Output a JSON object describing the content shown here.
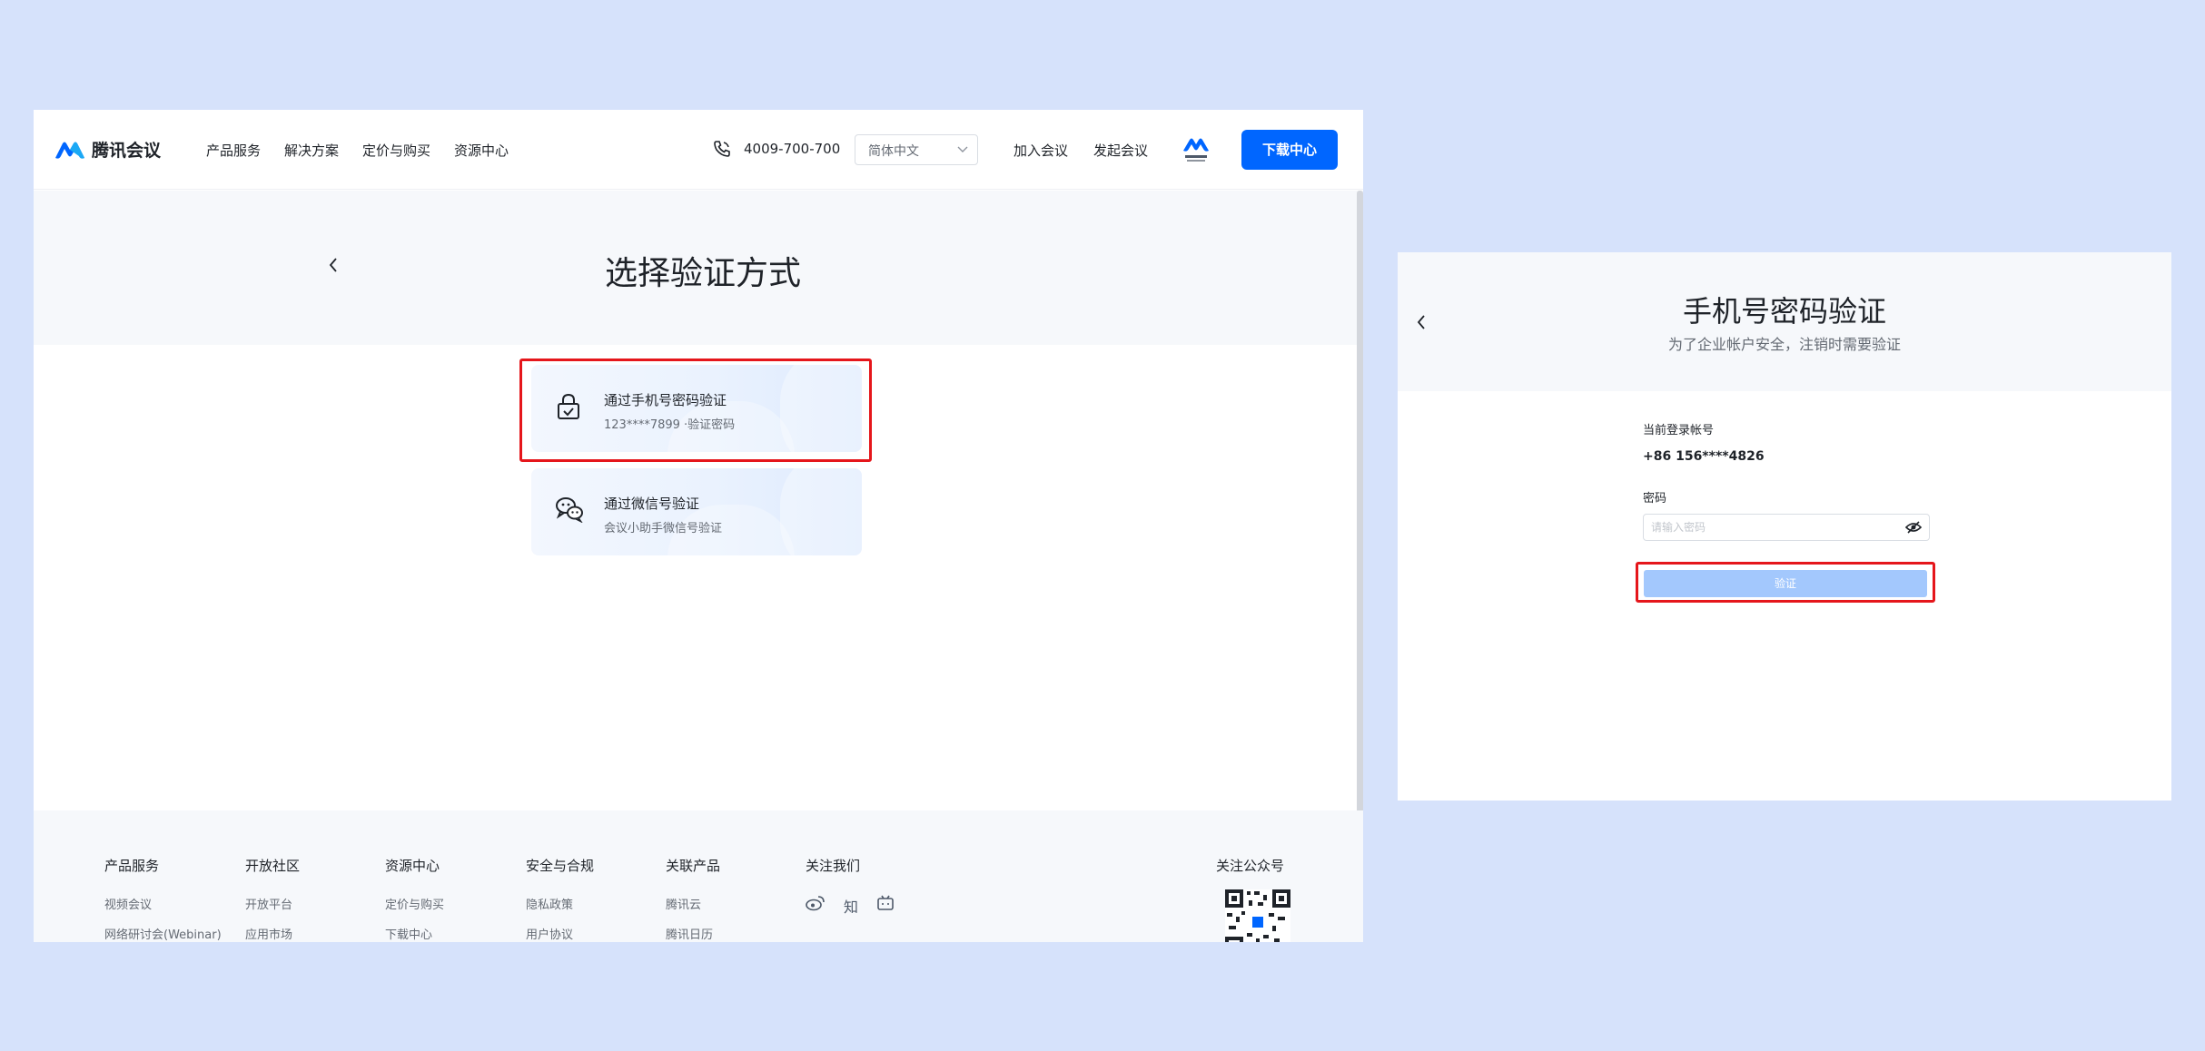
{
  "header": {
    "brand": "腾讯会议",
    "nav": [
      "产品服务",
      "解决方案",
      "定价与购买",
      "资源中心"
    ],
    "phone": "4009-700-700",
    "language": "简体中文",
    "join_meeting": "加入会议",
    "start_meeting": "发起会议",
    "download": "下载中心",
    "brand_color": "#0066ff"
  },
  "verify_select": {
    "title": "选择验证方式",
    "options": [
      {
        "title": "通过手机号密码验证",
        "subtitle": "123****7899 ·验证密码",
        "icon": "lock-check-icon"
      },
      {
        "title": "通过微信号验证",
        "subtitle": "会议小助手微信号验证",
        "icon": "wechat-icon"
      }
    ]
  },
  "footer": {
    "columns": [
      {
        "heading": "产品服务",
        "links": [
          "视频会议",
          "网络研讨会(Webinar)"
        ]
      },
      {
        "heading": "开放社区",
        "links": [
          "开放平台",
          "应用市场"
        ]
      },
      {
        "heading": "资源中心",
        "links": [
          "定价与购买",
          "下载中心"
        ]
      },
      {
        "heading": "安全与合规",
        "links": [
          "隐私政策",
          "用户协议"
        ]
      },
      {
        "heading": "关联产品",
        "links": [
          "腾讯云",
          "腾讯日历"
        ]
      }
    ],
    "follow_us": "关注我们",
    "social": [
      "weibo-icon",
      "知",
      "bilibili-icon"
    ],
    "official_account": "关注公众号"
  },
  "phone_verify": {
    "title": "手机号密码验证",
    "subtitle": "为了企业帐户安全，注销时需要验证",
    "account_label": "当前登录帐号",
    "account_value": "+86 156****4826",
    "password_label": "密码",
    "password_placeholder": "请输入密码",
    "verify_button": "验证",
    "highlight_color": "#e5161b"
  }
}
